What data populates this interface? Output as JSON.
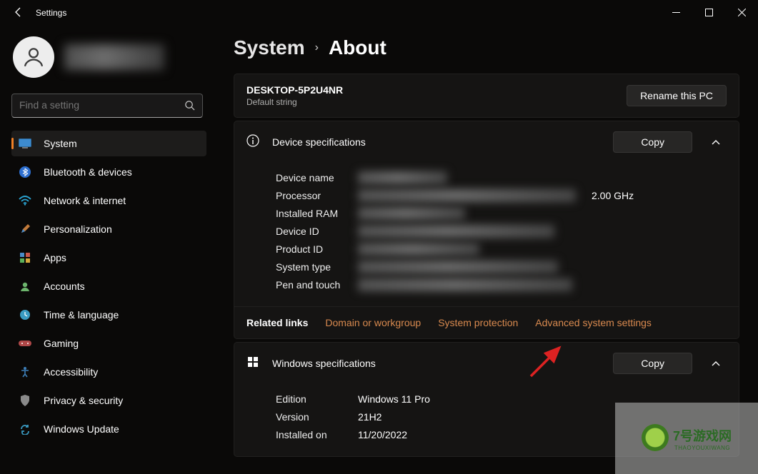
{
  "window": {
    "title": "Settings"
  },
  "search": {
    "placeholder": "Find a setting"
  },
  "nav": [
    {
      "label": "System",
      "icon": "🖥️",
      "color": "#4aa3df"
    },
    {
      "label": "Bluetooth & devices",
      "icon": "bt"
    },
    {
      "label": "Network & internet",
      "icon": "wifi"
    },
    {
      "label": "Personalization",
      "icon": "brush"
    },
    {
      "label": "Apps",
      "icon": "apps"
    },
    {
      "label": "Accounts",
      "icon": "acct"
    },
    {
      "label": "Time & language",
      "icon": "time"
    },
    {
      "label": "Gaming",
      "icon": "game"
    },
    {
      "label": "Accessibility",
      "icon": "acc"
    },
    {
      "label": "Privacy & security",
      "icon": "shield"
    },
    {
      "label": "Windows Update",
      "icon": "update"
    }
  ],
  "breadcrumb": {
    "parent": "System",
    "page": "About"
  },
  "device": {
    "name": "DESKTOP-5P2U4NR",
    "subtitle": "Default string",
    "rename_btn": "Rename this PC"
  },
  "devspec": {
    "title": "Device specifications",
    "copy": "Copy",
    "rows": {
      "devicename": "Device name",
      "processor": "Processor",
      "processor_freq": "2.00 GHz",
      "ram": "Installed RAM",
      "deviceid": "Device ID",
      "productid": "Product ID",
      "systype": "System type",
      "pentouch": "Pen and touch"
    }
  },
  "related": {
    "label": "Related links",
    "l1": "Domain or workgroup",
    "l2": "System protection",
    "l3": "Advanced system settings"
  },
  "winspec": {
    "title": "Windows specifications",
    "copy": "Copy",
    "rows": {
      "edition_lbl": "Edition",
      "edition_val": "Windows 11 Pro",
      "version_lbl": "Version",
      "version_val": "21H2",
      "installed_lbl": "Installed on",
      "installed_val": "11/20/2022"
    }
  },
  "watermark": {
    "brand": "7号游戏网",
    "sub": "THAOYOUXIWANG"
  }
}
